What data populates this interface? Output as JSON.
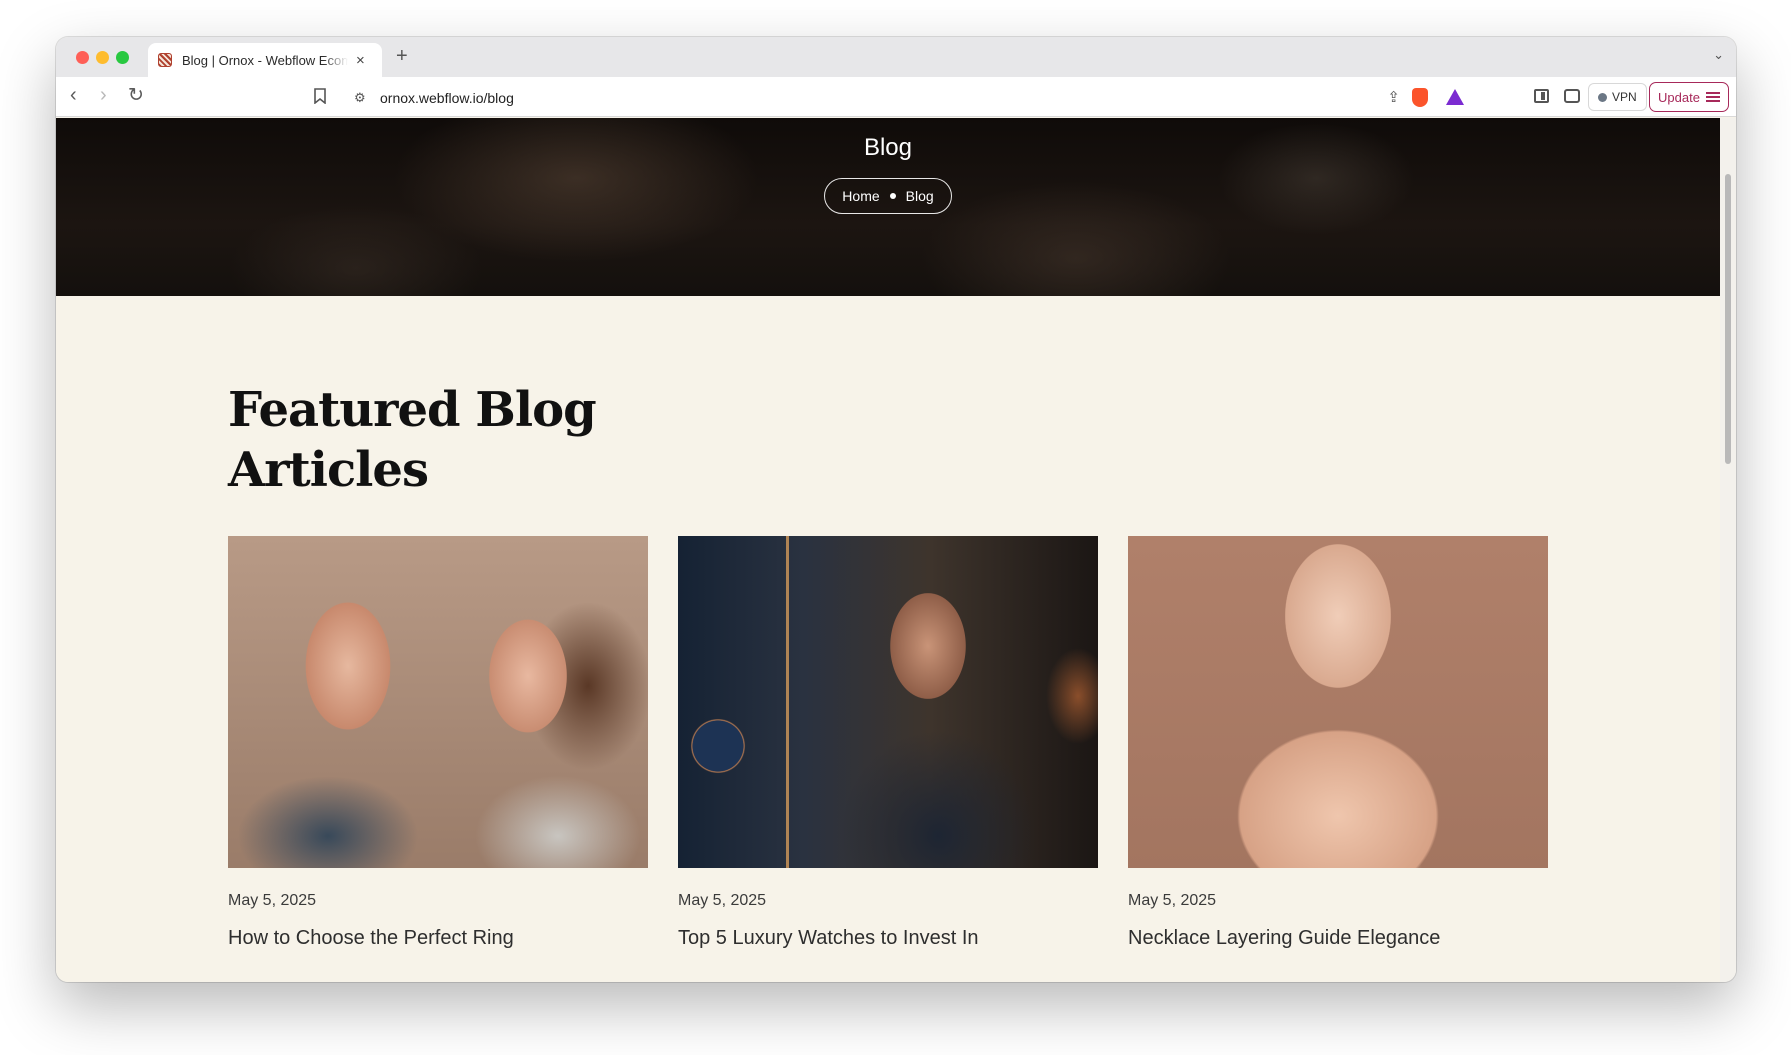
{
  "browser": {
    "tab": {
      "title": "Blog | Ornox - Webflow Ecom",
      "close_glyph": "×"
    },
    "new_tab_glyph": "+",
    "tabs_menu_glyph": "⌄",
    "url": "ornox.webflow.io/blog",
    "vpn_label": "VPN",
    "update_label": "Update",
    "icons": {
      "back": "‹",
      "forward": "›",
      "reload": "↻",
      "site_info": "⚙",
      "share": "⇪"
    }
  },
  "hero": {
    "title": "Blog",
    "breadcrumb": {
      "home": "Home",
      "current": "Blog"
    }
  },
  "featured": {
    "title": "Featured Blog Articles",
    "cards": [
      {
        "date": "May 5, 2025",
        "title": "How to Choose the Perfect Ring",
        "image": "couple-rings-photo"
      },
      {
        "date": "May 5, 2025",
        "title": "Top 5 Luxury Watches to Invest In",
        "image": "man-with-watch-photo"
      },
      {
        "date": "May 5, 2025",
        "title": "Necklace Layering Guide Elegance",
        "image": "woman-necklace-photo"
      }
    ]
  },
  "colors": {
    "page_bg": "#f7f3e9",
    "hero_bg": "#14100d",
    "update_accent": "#a7295a"
  }
}
